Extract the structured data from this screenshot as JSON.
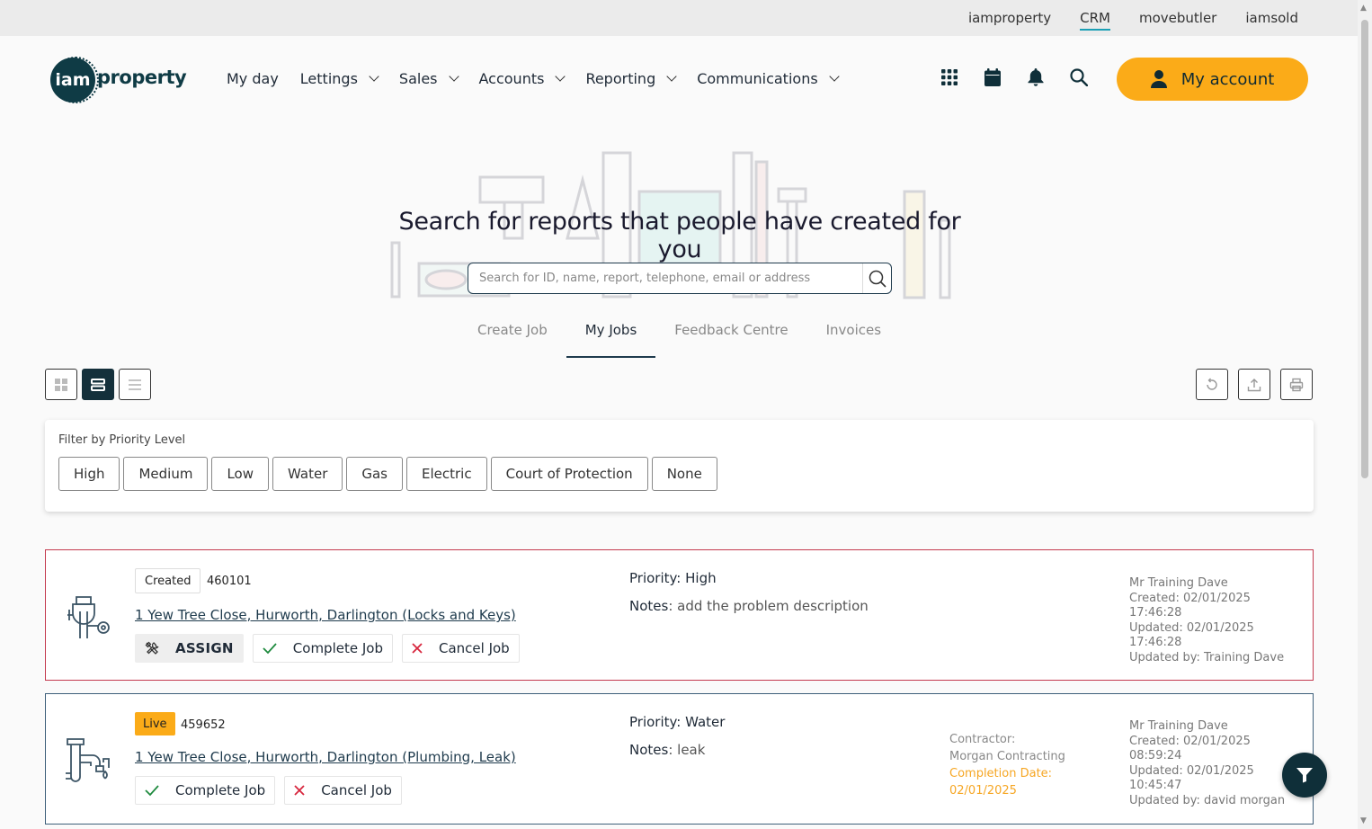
{
  "topbar": {
    "links": [
      "iamproperty",
      "CRM",
      "movebutler",
      "iamsold"
    ],
    "active": "CRM"
  },
  "logo": {
    "mark": "iam",
    "word": "property"
  },
  "nav": {
    "items": [
      "My day",
      "Lettings",
      "Sales",
      "Accounts",
      "Reporting",
      "Communications"
    ]
  },
  "header_icons": [
    "grid-icon",
    "calendar-icon",
    "bell-icon",
    "search-icon"
  ],
  "account": {
    "label": "My account"
  },
  "hero": {
    "title": "Search for reports that people have created for you",
    "search_placeholder": "Search for ID, name, report, telephone, email or address"
  },
  "tabs": [
    "Create Job",
    "My Jobs",
    "Feedback Centre",
    "Invoices"
  ],
  "active_tab": "My Jobs",
  "filter": {
    "label": "Filter by Priority Level",
    "chips": [
      "High",
      "Medium",
      "Low",
      "Water",
      "Gas",
      "Electric",
      "Court of Protection",
      "None"
    ]
  },
  "colors": {
    "accent": "#fbab18",
    "dark": "#0f2f39",
    "high_border": "#c43a4e",
    "water_border": "#3d5f7a",
    "completion": "#f6a623"
  },
  "jobs": [
    {
      "status": "Created",
      "id": "460101",
      "address": "1 Yew Tree Close, Hurworth, Darlington (Locks and Keys)",
      "actions": {
        "assign": "ASSIGN",
        "complete": "Complete Job",
        "cancel": "Cancel Job"
      },
      "priority": "Priority: High",
      "notes_label": "Notes",
      "notes": ": add the problem description",
      "meta": {
        "name": "Mr Training Dave",
        "created": "Created: 02/01/2025 17:46:28",
        "updated": "Updated: 02/01/2025 17:46:28",
        "updated_by": "Updated by: Training Dave"
      }
    },
    {
      "status": "Live",
      "id": "459652",
      "address": "1 Yew Tree Close, Hurworth, Darlington (Plumbing, Leak)",
      "actions": {
        "complete": "Complete Job",
        "cancel": "Cancel Job"
      },
      "priority": "Priority: Water",
      "notes_label": "Notes",
      "notes": ": leak",
      "contractor_label": "Contractor:",
      "contractor": "Morgan Contracting",
      "completion_label": "Completion Date:",
      "completion_date": "02/01/2025",
      "meta": {
        "name": "Mr Training Dave",
        "created": "Created: 02/01/2025 08:59:24",
        "updated": "Updated: 02/01/2025 10:45:47",
        "updated_by": "Updated by: david morgan"
      }
    }
  ]
}
